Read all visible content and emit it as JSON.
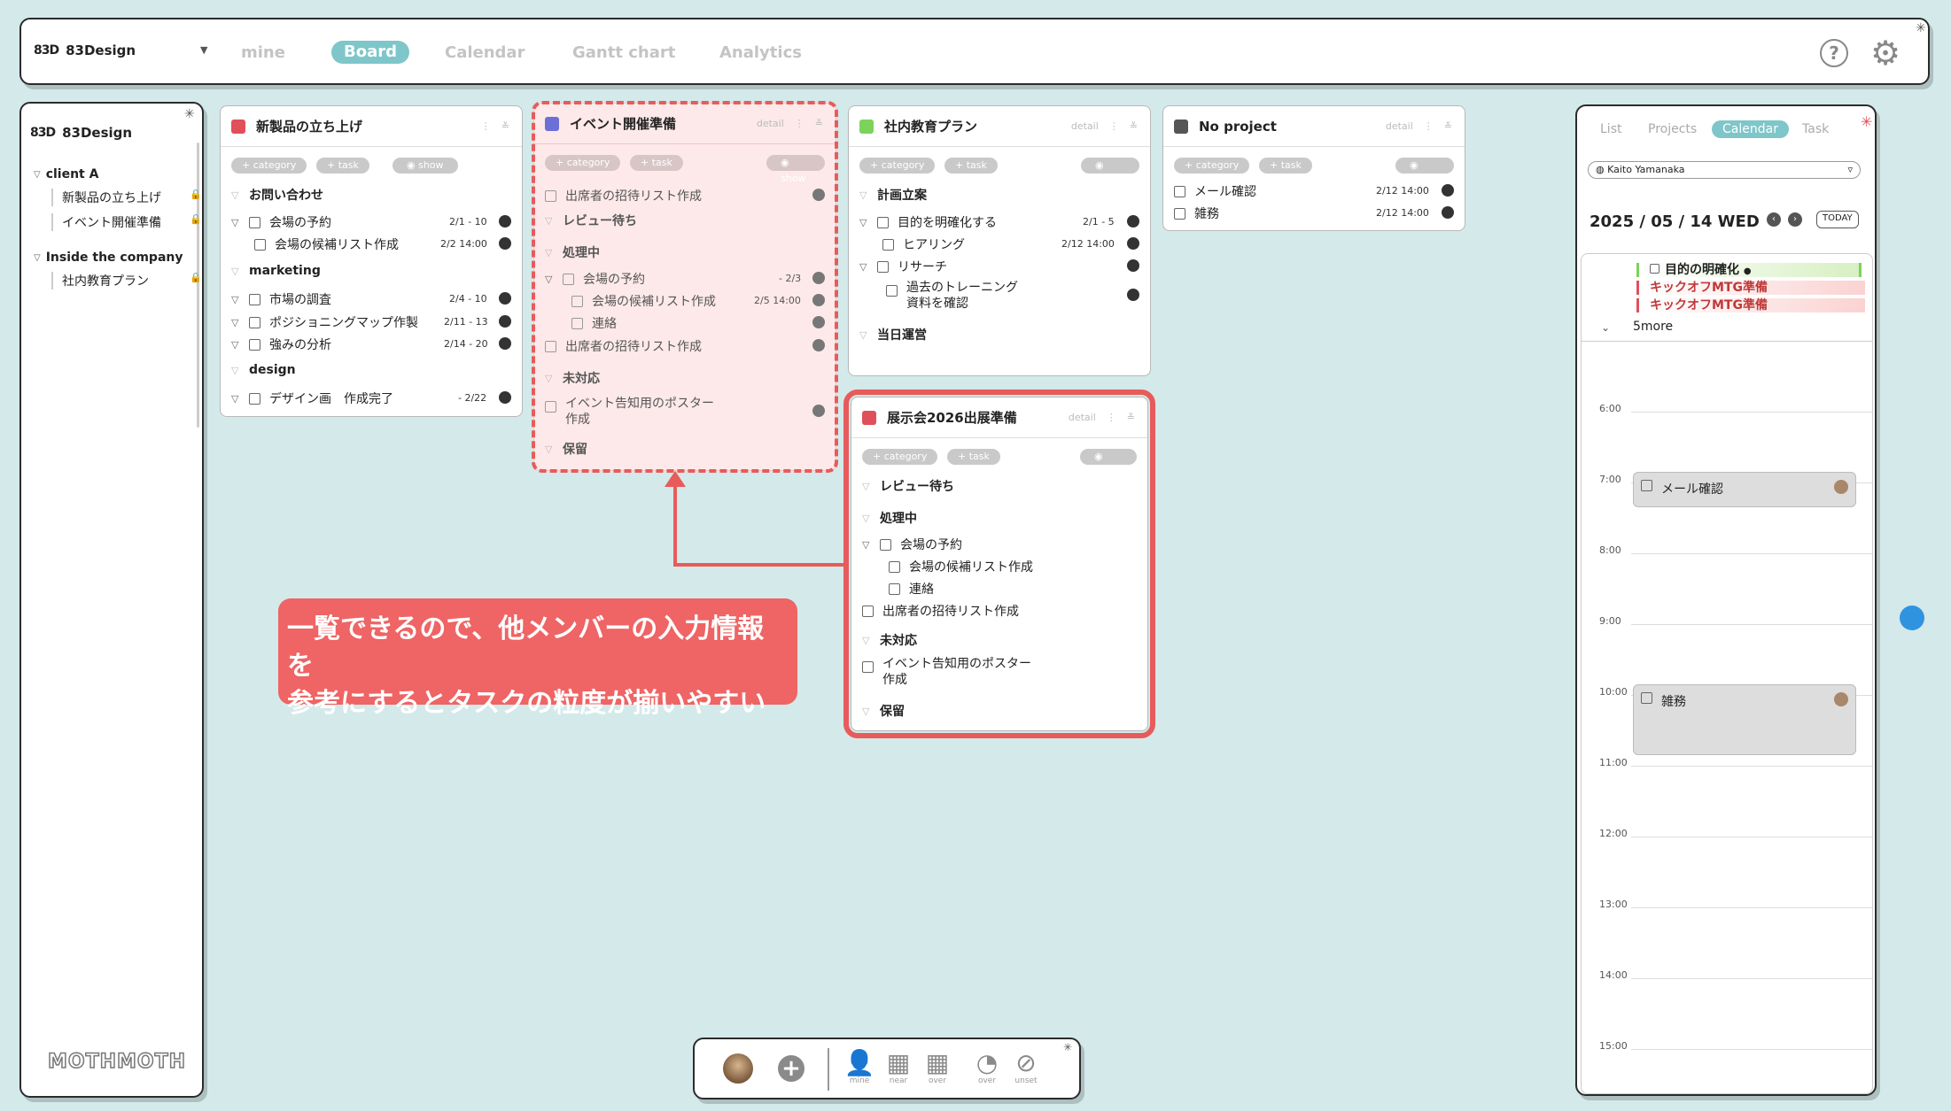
{
  "app": {
    "logo_mark": "83D",
    "name": "83Design"
  },
  "topbar": {
    "tabs": [
      {
        "label": "mine",
        "active": false
      },
      {
        "label": "Board",
        "active": true
      },
      {
        "label": "Calendar",
        "active": false
      },
      {
        "label": "Gantt chart",
        "active": false
      },
      {
        "label": "Analytics",
        "active": false
      }
    ],
    "help_glyph": "?",
    "settings_glyph": "⚙"
  },
  "sidebar": {
    "logo_mark": "83D",
    "name": "83Design",
    "groups": [
      {
        "label": "client A",
        "items": [
          "新製品の立ち上げ",
          "イベント開催準備"
        ]
      },
      {
        "label": "Inside the company",
        "items": [
          "社内教育プラン"
        ]
      }
    ],
    "brand": "MOTHMOTH"
  },
  "chips": {
    "category": "+ category",
    "task": "+ task",
    "show": "show"
  },
  "detail_label": "detail",
  "boards": {
    "b1": {
      "title": "新製品の立ち上げ",
      "color": "#e0505a",
      "s1": "お問い合わせ",
      "t1": "会場の予約",
      "d1": "2/1 - 10",
      "t2": "会場の候補リスト作成",
      "d2": "2/2 14:00",
      "s2": "marketing",
      "t3": "市場の調査",
      "d3": "2/4 - 10",
      "t4": "ポジショニングマップ作製",
      "d4": "2/11 - 13",
      "t5": "強みの分析",
      "d5": "2/14 - 20",
      "s3": "design",
      "t6": "デザイン画　作成完了",
      "d6": "- 2/22"
    },
    "b2": {
      "title": "イベント開催準備",
      "color": "#6b6fd6",
      "t1": "出席者の招待リスト作成",
      "s1": "レビュー待ち",
      "s2": "処理中",
      "t2": "会場の予約",
      "d2": "- 2/3",
      "t3": "会場の候補リスト作成",
      "d3": "2/5 14:00",
      "t4": "連絡",
      "t5": "出席者の招待リスト作成",
      "s3": "未対応",
      "t6a": "イベント告知用のポスター",
      "t6b": "作成",
      "s4": "保留"
    },
    "b3": {
      "title": "社内教育プラン",
      "color": "#7bd35b",
      "s1": "計画立案",
      "t1": "目的を明確化する",
      "d1": "2/1 - 5",
      "t2": "ヒアリング",
      "d2": "2/12 14:00",
      "t3": "リサーチ",
      "t4a": "過去のトレーニング",
      "t4b": "資料を確認",
      "s2": "当日運営"
    },
    "b4": {
      "title": "No project",
      "color": "#555555",
      "t1": "メール確認",
      "d1": "2/12 14:00",
      "t2": "雑務",
      "d2": "2/12 14:00"
    },
    "b5": {
      "title": "展示会2026出展準備",
      "color": "#e0505a",
      "s1": "レビュー待ち",
      "s2": "処理中",
      "t1": "会場の予約",
      "t2": "会場の候補リスト作成",
      "t3": "連絡",
      "t4": "出席者の招待リスト作成",
      "s3": "未対応",
      "t5a": "イベント告知用のポスター",
      "t5b": "作成",
      "s4": "保留"
    }
  },
  "callout": {
    "line1": "一覧できるので、他メンバーの入力情報を",
    "line2": "参考にするとタスクの粒度が揃いやすい"
  },
  "calendar": {
    "tabs": [
      {
        "label": "List"
      },
      {
        "label": "Projects"
      },
      {
        "label": "Calendar",
        "active": true
      },
      {
        "label": "Task"
      }
    ],
    "user": "Kaito Yamanaka",
    "date": "2025 / 05 / 14 WED",
    "today": "TODAY",
    "allday": [
      {
        "label": "目的の明確化",
        "color": "#b9e39a"
      },
      {
        "label": "キックオフMTG準備",
        "color": "#f6c9c9"
      },
      {
        "label": "キックオフMTG準備",
        "color": "#f6c9c9"
      }
    ],
    "more": "5more",
    "hours": [
      "6:00",
      "7:00",
      "8:00",
      "9:00",
      "10:00",
      "11:00",
      "12:00",
      "13:00",
      "14:00",
      "15:00"
    ],
    "events": [
      {
        "label": "メール確認"
      },
      {
        "label": "雑務"
      }
    ]
  },
  "bottombar": {
    "add_glyph": "+",
    "tools": [
      {
        "label": "mine"
      },
      {
        "label": "near"
      },
      {
        "label": "over"
      },
      {
        "label": "over"
      },
      {
        "label": "unset"
      }
    ]
  }
}
